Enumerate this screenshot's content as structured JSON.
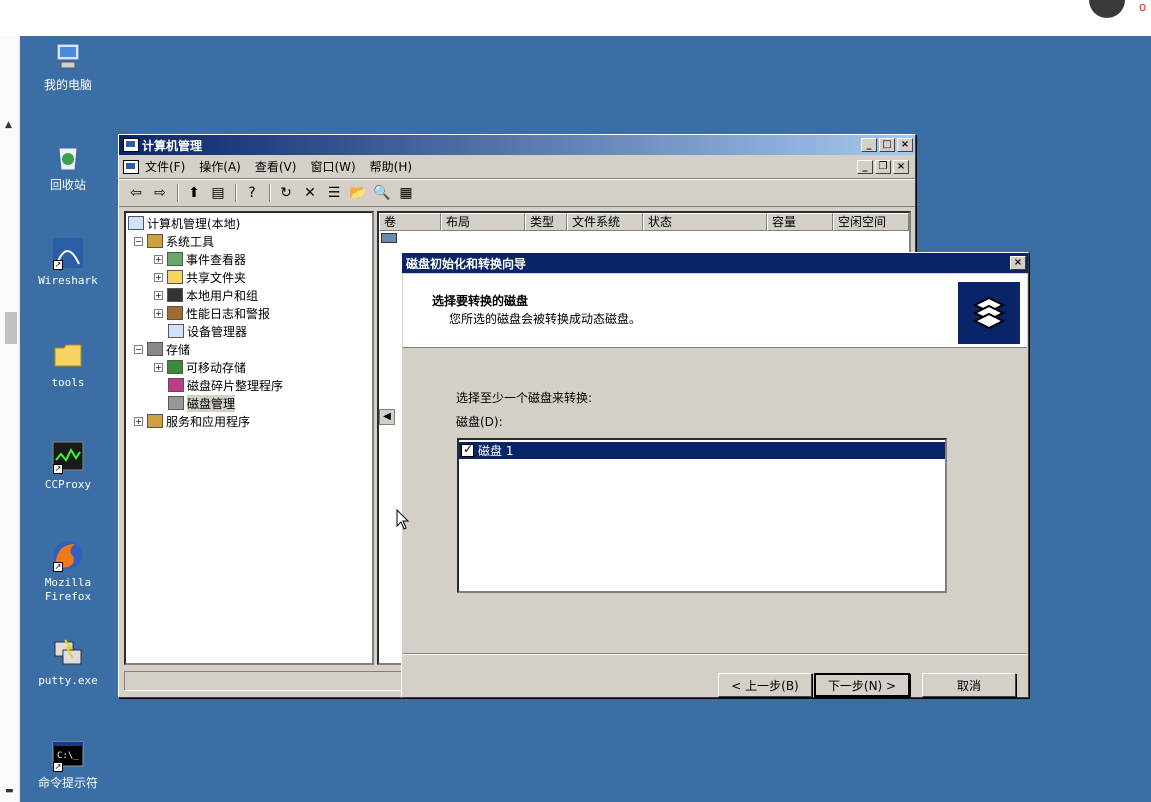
{
  "desktop": {
    "icons": [
      {
        "label": "我的电脑",
        "icon": "my-computer-icon"
      },
      {
        "label": "回收站",
        "icon": "recycle-bin-icon"
      },
      {
        "label": "Wireshark",
        "icon": "wireshark-icon"
      },
      {
        "label": "tools",
        "icon": "folder-icon"
      },
      {
        "label": "CCProxy",
        "icon": "ccproxy-icon"
      },
      {
        "label": "Mozilla Firefox",
        "icon": "firefox-icon"
      },
      {
        "label": "putty.exe",
        "icon": "putty-icon"
      },
      {
        "label": "命令提示符",
        "icon": "cmd-icon"
      }
    ]
  },
  "mgmt": {
    "title": "计算机管理",
    "menu": [
      "文件(F)",
      "操作(A)",
      "查看(V)",
      "窗口(W)",
      "帮助(H)"
    ],
    "tree": {
      "root": "计算机管理(本地)",
      "system_tools": "系统工具",
      "event_viewer": "事件查看器",
      "shared_folders": "共享文件夹",
      "local_users": "本地用户和组",
      "perf_logs": "性能日志和警报",
      "device_manager": "设备管理器",
      "storage": "存储",
      "removable": "可移动存储",
      "defrag": "磁盘碎片整理程序",
      "disk_mgmt": "磁盘管理",
      "services_apps": "服务和应用程序"
    },
    "columns": [
      "卷",
      "布局",
      "类型",
      "文件系统",
      "状态",
      "容量",
      "空闲空间"
    ]
  },
  "wizard": {
    "title": "磁盘初始化和转换向导",
    "header_title": "选择要转换的磁盘",
    "header_subtitle": "您所选的磁盘会被转换成动态磁盘。",
    "instruction": "选择至少一个磁盘来转换:",
    "list_label": "磁盘(D):",
    "disk_item": "磁盘 1",
    "disk_checked": true,
    "back_label": "< 上一步(B)",
    "next_label": "下一步(N) >",
    "cancel_label": "取消"
  }
}
